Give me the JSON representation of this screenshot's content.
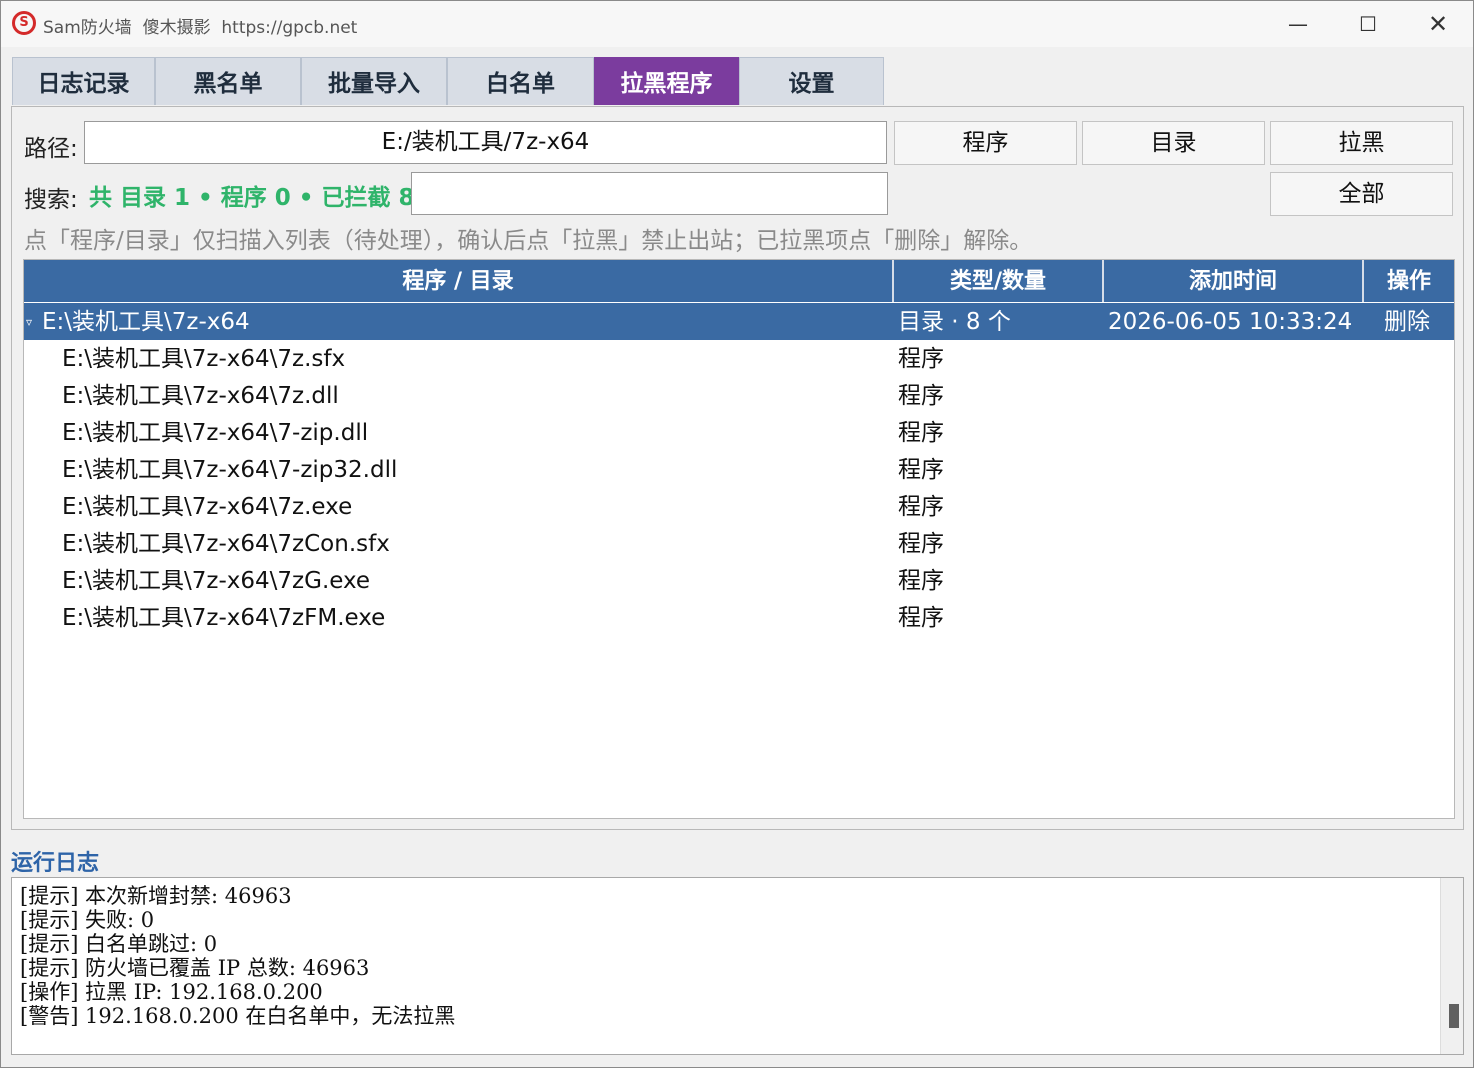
{
  "window": {
    "title": "Sam防火墙  傻木摄影  https://gpcb.net",
    "icon_glyph": "S",
    "controls": {
      "minimize": "—",
      "maximize": "☐",
      "close": "✕"
    }
  },
  "tabs": [
    {
      "label": "日志记录",
      "active": false
    },
    {
      "label": "黑名单",
      "active": false
    },
    {
      "label": "批量导入",
      "active": false
    },
    {
      "label": "白名单",
      "active": false
    },
    {
      "label": "拉黑程序",
      "active": true
    },
    {
      "label": "设置",
      "active": false
    }
  ],
  "panel": {
    "path_label": "路径:",
    "path_value": "E:/装机工具/7z-x64",
    "buttons": {
      "program": "程序",
      "directory": "目录",
      "block": "拉黑",
      "all": "全部"
    },
    "search_label": "搜索:",
    "stats": "共 目录 1 • 程序 0 • 已拦截 8",
    "search_value": "",
    "hint": "点「程序/目录」仅扫描入列表（待处理），确认后点「拉黑」禁止出站；已拉黑项点「删除」解除。"
  },
  "table": {
    "columns": [
      "程序 / 目录",
      "类型/数量",
      "添加时间",
      "操作"
    ],
    "parent": {
      "expander": "▿",
      "path": "E:\\装机工具\\7z-x64",
      "type": "目录 · 8 个",
      "time": "2026-06-05 10:33:24",
      "action": "删除"
    },
    "children": [
      {
        "path": "E:\\装机工具\\7z-x64\\7z.sfx",
        "type": "程序"
      },
      {
        "path": "E:\\装机工具\\7z-x64\\7z.dll",
        "type": "程序"
      },
      {
        "path": "E:\\装机工具\\7z-x64\\7-zip.dll",
        "type": "程序"
      },
      {
        "path": "E:\\装机工具\\7z-x64\\7-zip32.dll",
        "type": "程序"
      },
      {
        "path": "E:\\装机工具\\7z-x64\\7z.exe",
        "type": "程序"
      },
      {
        "path": "E:\\装机工具\\7z-x64\\7zCon.sfx",
        "type": "程序"
      },
      {
        "path": "E:\\装机工具\\7z-x64\\7zG.exe",
        "type": "程序"
      },
      {
        "path": "E:\\装机工具\\7z-x64\\7zFM.exe",
        "type": "程序"
      }
    ]
  },
  "log": {
    "title": "运行日志",
    "lines": [
      "[提示] 本次新增封禁: 46963",
      "[提示] 失败: 0",
      "[提示] 白名单跳过: 0",
      "[提示] 防火墙已覆盖 IP 总数: 46963",
      "[操作] 拉黑 IP: 192.168.0.200",
      "[警告] 192.168.0.200 在白名单中，无法拉黑"
    ]
  },
  "colors": {
    "active_tab": "#7b3c9e",
    "table_header": "#3a6aa3",
    "stats_green": "#2fb46a",
    "log_title": "#2e64a8"
  }
}
